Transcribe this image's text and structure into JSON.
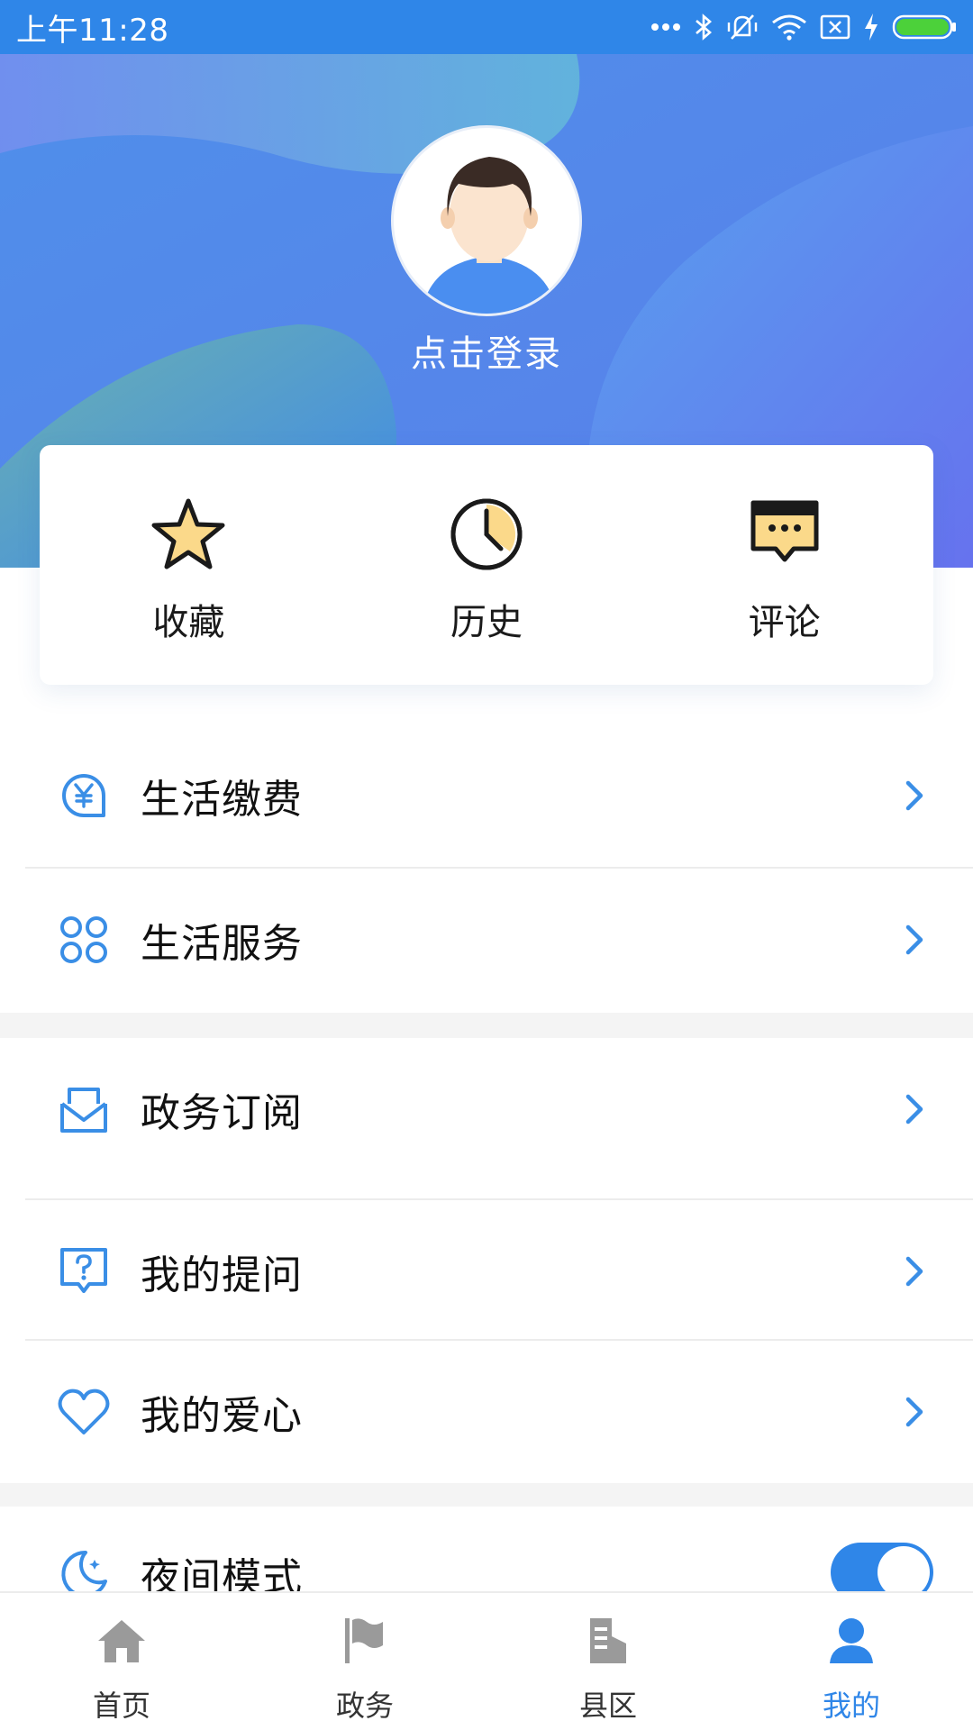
{
  "status_bar": {
    "time": "上午11:28",
    "icons": [
      "more-dots-icon",
      "bluetooth-icon",
      "mute-vibrate-icon",
      "wifi-icon",
      "sim-off-icon",
      "charging-icon",
      "battery-icon"
    ]
  },
  "header": {
    "login_text": "点击登录"
  },
  "quick_actions": [
    {
      "label": "收藏",
      "icon": "star-icon"
    },
    {
      "label": "历史",
      "icon": "clock-icon"
    },
    {
      "label": "评论",
      "icon": "comment-icon"
    }
  ],
  "menu": {
    "group1": [
      {
        "label": "生活缴费",
        "icon": "yuan-bill-icon"
      },
      {
        "label": "生活服务",
        "icon": "grid-services-icon"
      }
    ],
    "group2": [
      {
        "label": "政务订阅",
        "icon": "mail-inbox-icon"
      },
      {
        "label": "我的提问",
        "icon": "question-bubble-icon"
      },
      {
        "label": "我的爱心",
        "icon": "heart-icon"
      }
    ],
    "night_mode": {
      "label": "夜间模式",
      "icon": "moon-icon",
      "enabled": true
    }
  },
  "bottom_nav": [
    {
      "label": "首页",
      "icon": "home-icon",
      "active": false
    },
    {
      "label": "政务",
      "icon": "flag-icon",
      "active": false
    },
    {
      "label": "县区",
      "icon": "building-icon",
      "active": false
    },
    {
      "label": "我的",
      "icon": "user-icon",
      "active": true
    }
  ],
  "colors": {
    "accent": "#2f86e8",
    "status_bar": "#2f86e8",
    "icon_blue": "#3a8ee6",
    "star_fill": "#fbd98a",
    "nav_inactive": "#9a9a9a"
  }
}
